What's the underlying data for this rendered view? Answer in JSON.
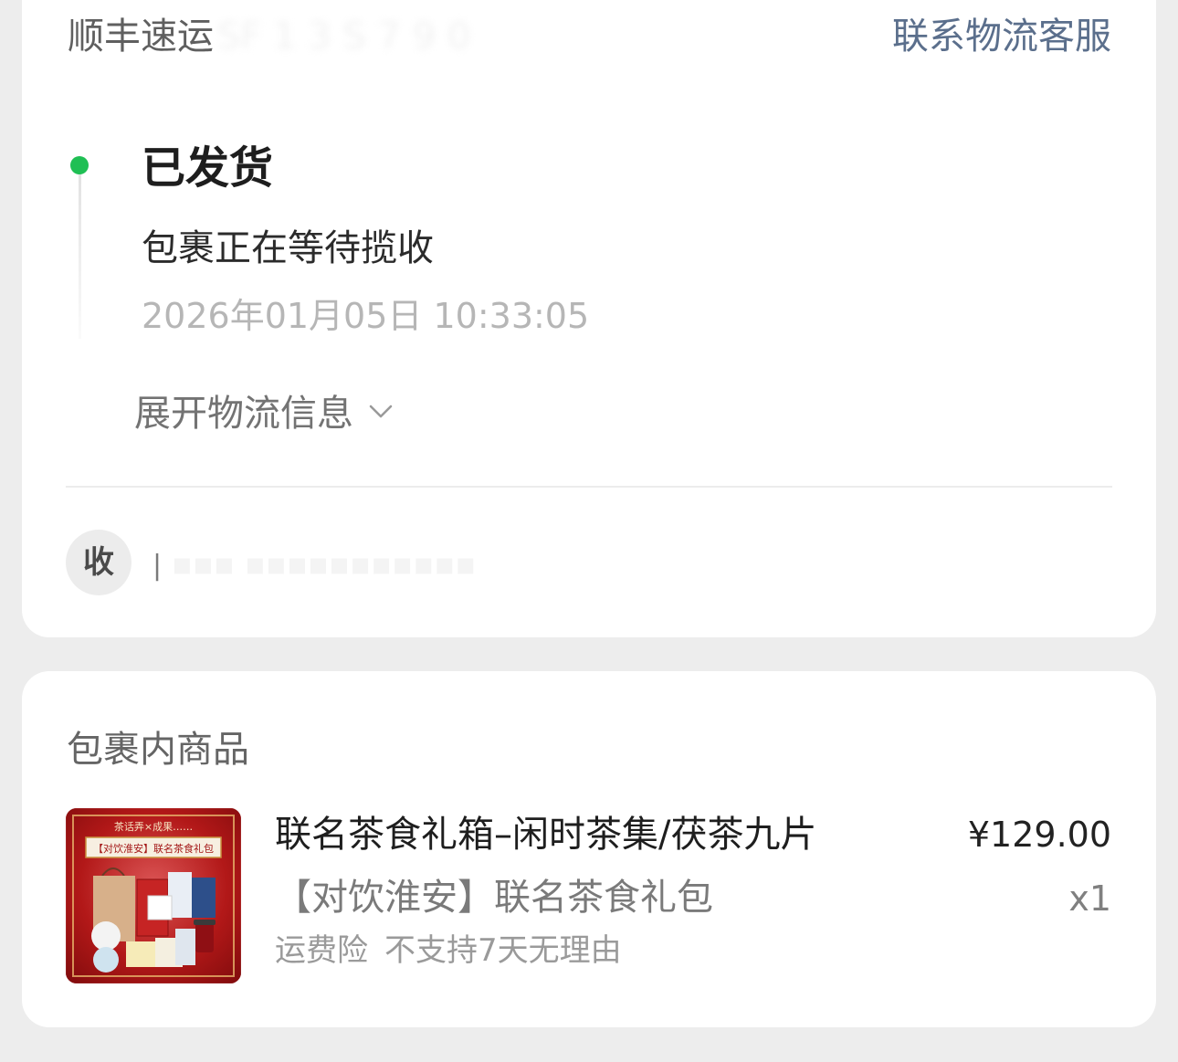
{
  "logistics": {
    "carrier_name": "顺丰速运",
    "tracking_number_masked": "SF 1 3 S 7 9 0",
    "contact_link_label": "联系物流客服",
    "status": {
      "title": "已发货",
      "description": "包裹正在等待揽收",
      "timestamp": "2026年01月05日 10:33:05",
      "dot_color": "#1fbf54"
    },
    "expand_label": "展开物流信息",
    "expand_icon": "chevron-down-icon",
    "receiver": {
      "badge_label": "收",
      "separator": "|",
      "info_masked": "▪▪▪ ▪▪▪▪▪▪▪▪▪▪▪"
    }
  },
  "items": {
    "heading": "包裹内商品",
    "products": [
      {
        "title": "联名茶食礼箱–闲时茶集/茯茶九片",
        "spec": "【对饮淮安】联名茶食礼包",
        "tags": [
          "运费险",
          "不支持7天无理由"
        ],
        "price": "¥129.00",
        "quantity": "x1",
        "image": {
          "header_text": "茶话弄×成果……",
          "banner_text": "【对饮淮安】联名茶食礼包",
          "accent_color": "#b21818"
        }
      }
    ]
  },
  "colors": {
    "link": "#5b6f8c",
    "status_green": "#1fbf54",
    "background": "#ededed"
  }
}
